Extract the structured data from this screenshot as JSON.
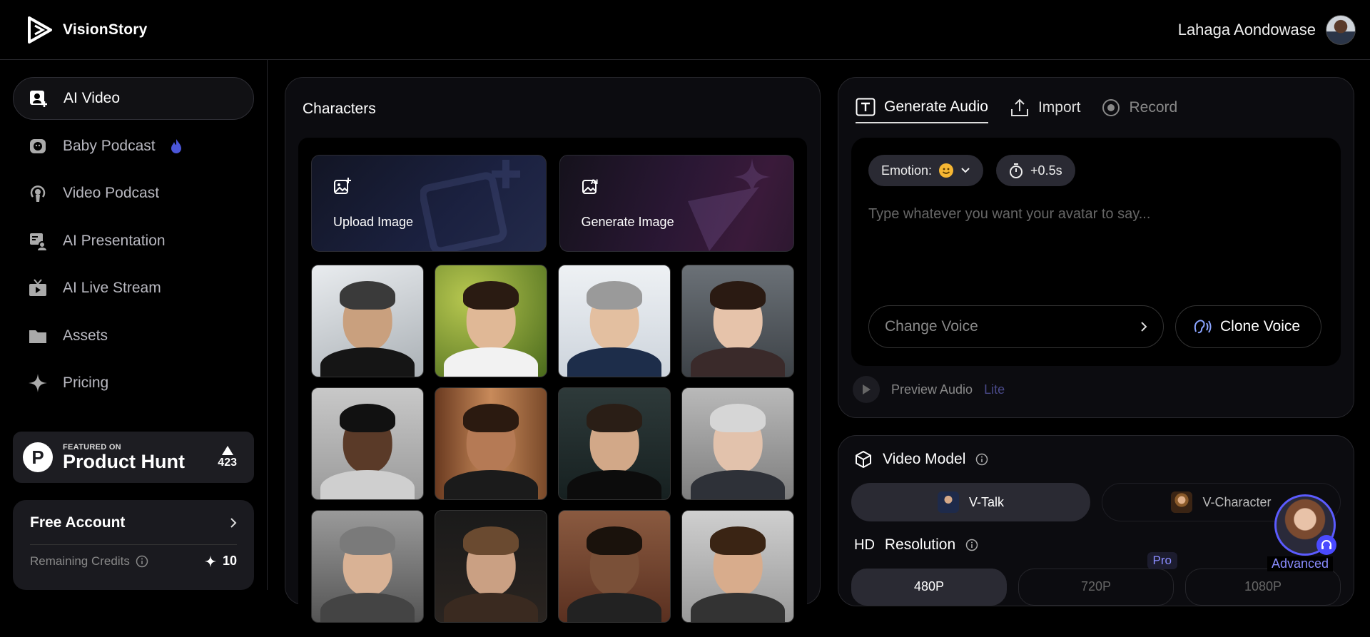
{
  "app": {
    "name": "VisionStory"
  },
  "user": {
    "name": "Lahaga Aondowase"
  },
  "sidebar": {
    "items": [
      {
        "label": "AI Video",
        "icon": "ai-video-icon",
        "active": true
      },
      {
        "label": "Baby Podcast",
        "icon": "baby-podcast-icon",
        "active": false
      },
      {
        "label": "Video Podcast",
        "icon": "podcast-icon",
        "active": false
      },
      {
        "label": "AI Presentation",
        "icon": "presentation-icon",
        "active": false
      },
      {
        "label": "AI Live Stream",
        "icon": "tv-icon",
        "active": false
      },
      {
        "label": "Assets",
        "icon": "folder-icon",
        "active": false
      },
      {
        "label": "Pricing",
        "icon": "sparkle-icon",
        "active": false
      }
    ],
    "product_hunt": {
      "featured": "FEATURED ON",
      "name": "Product Hunt",
      "votes": "423"
    },
    "account": {
      "title": "Free Account",
      "credits_label": "Remaining Credits",
      "credits": "10"
    }
  },
  "characters": {
    "title": "Characters",
    "upload_label": "Upload Image",
    "generate_label": "Generate Image"
  },
  "audio": {
    "tabs": [
      {
        "label": "Generate Audio",
        "active": true
      },
      {
        "label": "Import",
        "active": false
      },
      {
        "label": "Record",
        "active": false
      }
    ],
    "emotion_label": "Emotion:",
    "pause_label": "+0.5s",
    "placeholder": "Type whatever you want your avatar to say...",
    "change_voice": "Change Voice",
    "clone_voice": "Clone Voice",
    "preview_label": "Preview Audio",
    "preview_tag": "Lite"
  },
  "video_model": {
    "title": "Video Model",
    "options": [
      {
        "label": "V-Talk",
        "active": true
      },
      {
        "label": "V-Character",
        "active": false
      }
    ]
  },
  "resolution": {
    "title": "Resolution",
    "icon_text": "HD",
    "options": [
      {
        "label": "480P",
        "active": true
      },
      {
        "label": "720P",
        "active": false
      },
      {
        "label": "1080P",
        "active": false
      }
    ],
    "pro_badge": "Pro"
  },
  "assistant": {
    "label": "Advanced"
  },
  "colors": {
    "accent": "#5b5bff",
    "pro": "#8a8cff",
    "background": "#000000",
    "panel": "#0c0c10"
  }
}
